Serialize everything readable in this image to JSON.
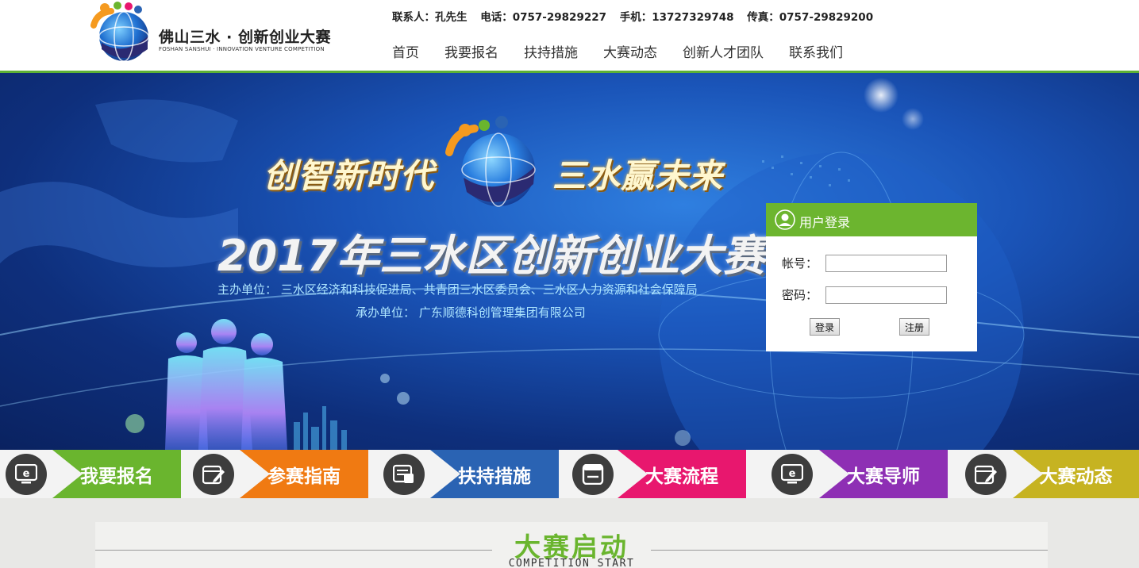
{
  "header": {
    "logo_title": "佛山三水 · 创新创业大赛",
    "logo_subtitle": "FOSHAN SANSHUI · INNOVATION VENTURE COMPETITION",
    "contact": {
      "person": "联系人：孔先生",
      "phone": "电话：0757-29829227",
      "mobile": "手机：13727329748",
      "fax": "传真：0757-29829200"
    },
    "nav": [
      "首页",
      "我要报名",
      "扶持措施",
      "大赛动态",
      "创新人才团队",
      "联系我们"
    ]
  },
  "banner": {
    "slogan_left": "创智新时代",
    "slogan_right": "三水赢未来",
    "title": "2017年三水区创新创业大赛",
    "organizer": "主办单位： 三水区经济和科技促进局、共青团三水区委员会、三水区人力资源和社会保障局",
    "co_organizer": "承办单位： 广东顺德科创管理集团有限公司"
  },
  "login": {
    "title": "用户登录",
    "account_label": "帐号：",
    "account_value": "",
    "password_label": "密码：",
    "password_value": "",
    "login_button": "登录",
    "register_button": "注册"
  },
  "quick_links": [
    {
      "label": "我要报名",
      "color": "#6ab52e",
      "icon": "e-screen-icon"
    },
    {
      "label": "参赛指南",
      "color": "#f07a12",
      "icon": "edit-note-icon"
    },
    {
      "label": "扶持措施",
      "color": "#2a63b3",
      "icon": "document-icon"
    },
    {
      "label": "大赛流程",
      "color": "#e8176e",
      "icon": "browser-window-icon"
    },
    {
      "label": "大赛导师",
      "color": "#8e2fb4",
      "icon": "e-screen-icon"
    },
    {
      "label": "大赛动态",
      "color": "#c6b321",
      "icon": "edit-note-icon"
    }
  ],
  "section": {
    "title": "大赛启动",
    "subtitle": "COMPETITION START"
  },
  "colors": {
    "brand_green": "#6ab52e",
    "header_line": "#5db135"
  }
}
